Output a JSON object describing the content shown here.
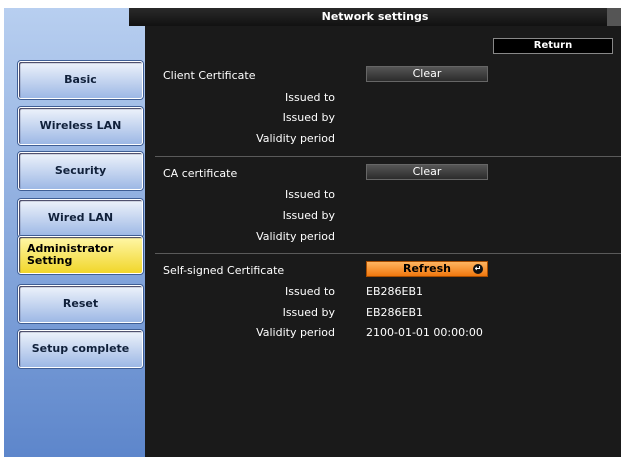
{
  "window": {
    "title": "Network settings"
  },
  "sidebar": {
    "items": [
      {
        "label": "Basic"
      },
      {
        "label": "Wireless LAN"
      },
      {
        "label": "Security"
      },
      {
        "label": "Wired LAN"
      },
      {
        "label": "Administrator Setting"
      },
      {
        "label": "Reset"
      },
      {
        "label": "Setup complete"
      }
    ]
  },
  "toolbar": {
    "return_label": "Return"
  },
  "client_cert": {
    "label": "Client Certificate",
    "button": "Clear",
    "issued_to": "Issued to",
    "issued_by": "Issued by",
    "validity": "Validity period"
  },
  "ca_cert": {
    "label": "CA certificate",
    "button": "Clear",
    "issued_to": "Issued to",
    "issued_by": "Issued by",
    "validity": "Validity period"
  },
  "self_signed": {
    "label": "Self-signed Certificate",
    "button": "Refresh",
    "issued_to": "Issued to",
    "issued_to_value": "EB286EB1",
    "issued_by": "Issued by",
    "issued_by_value": "EB286EB1",
    "validity": "Validity period",
    "validity_value": "2100-01-01 00:00:00"
  },
  "colors": {
    "accent_active": "#f1d62a",
    "refresh_button": "#f0780e"
  }
}
